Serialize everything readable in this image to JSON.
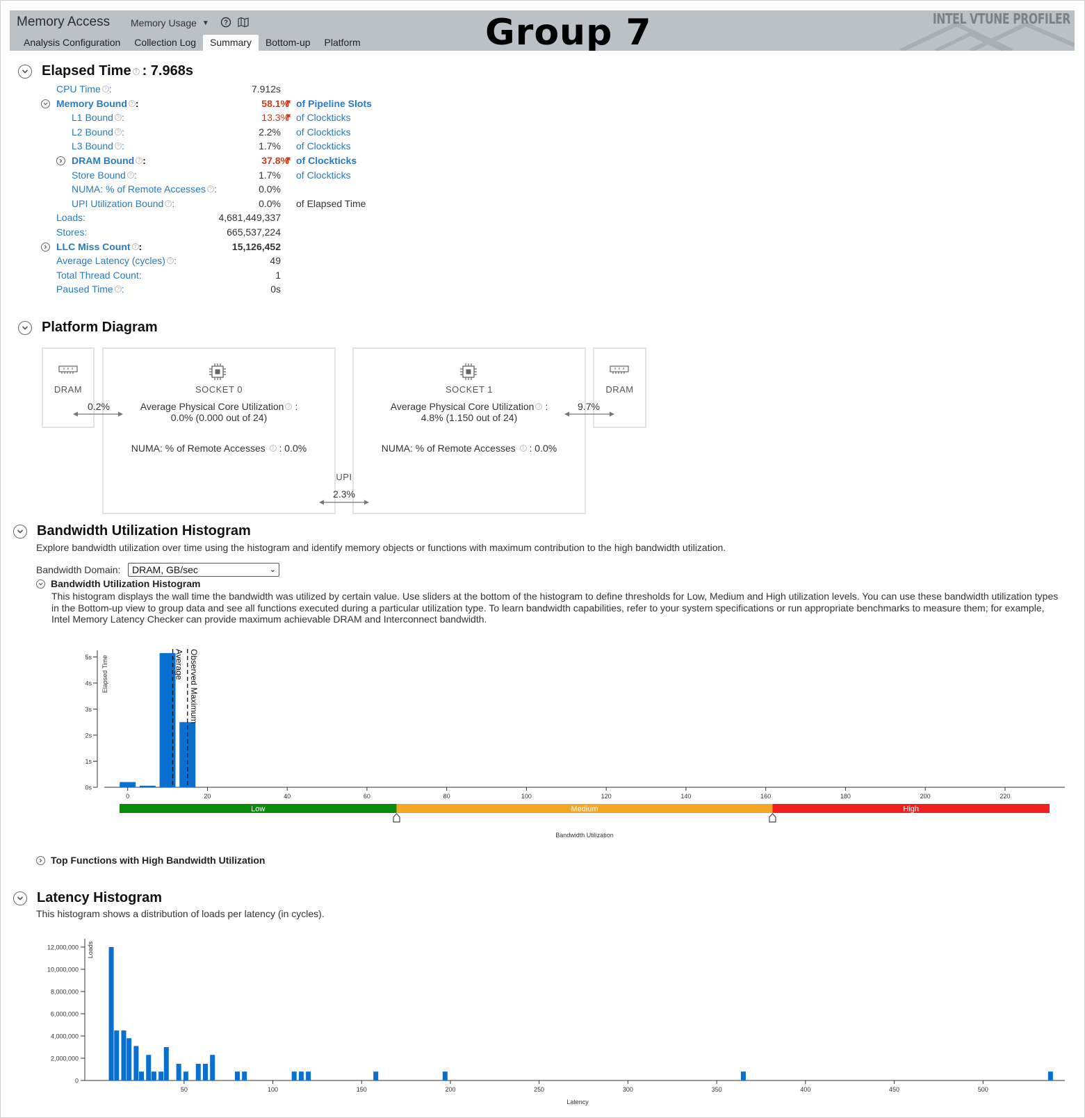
{
  "header": {
    "app_title": "Memory Access",
    "view_dropdown": "Memory Usage",
    "group_title": "Group 7",
    "brand": "INTEL VTUNE PROFILER",
    "tabs": [
      "Analysis Configuration",
      "Collection Log",
      "Summary",
      "Bottom-up",
      "Platform"
    ],
    "active_tab": "Summary"
  },
  "elapsed": {
    "title": "Elapsed Time",
    "value": ": 7.968s",
    "metrics": [
      {
        "label": "CPU Time",
        "value": "7.912s",
        "unit": "",
        "indent": 0,
        "help": true
      },
      {
        "label": "Memory Bound",
        "value": "58.1%",
        "unit": "of Pipeline Slots",
        "indent": 0,
        "help": true,
        "bold": true,
        "red": true,
        "flag": true,
        "toggle": "expanded"
      },
      {
        "label": "L1 Bound",
        "value": "13.3%",
        "unit": "of Clockticks",
        "indent": 1,
        "help": true,
        "red": true,
        "flag": true
      },
      {
        "label": "L2 Bound",
        "value": "2.2%",
        "unit": "of Clockticks",
        "indent": 1,
        "help": true
      },
      {
        "label": "L3 Bound",
        "value": "1.7%",
        "unit": "of Clockticks",
        "indent": 1,
        "help": true
      },
      {
        "label": "DRAM Bound",
        "value": "37.8%",
        "unit": "of Clockticks",
        "indent": 1,
        "help": true,
        "bold": true,
        "red": true,
        "flag": true,
        "toggle": "collapsed"
      },
      {
        "label": "Store Bound",
        "value": "1.7%",
        "unit": "of Clockticks",
        "indent": 1,
        "help": true
      },
      {
        "label": "NUMA: % of Remote Accesses",
        "value": "0.0%",
        "unit": "",
        "indent": 1,
        "help": true
      },
      {
        "label": "UPI Utilization Bound",
        "value": "0.0%",
        "unit": "of Elapsed Time",
        "indent": 1,
        "help": true,
        "unit_dark": true
      },
      {
        "label": "Loads",
        "value": "4,681,449,337",
        "unit": "",
        "indent": 0,
        "help": false
      },
      {
        "label": "Stores",
        "value": "665,537,224",
        "unit": "",
        "indent": 0,
        "help": false
      },
      {
        "label": "LLC Miss Count",
        "value": "15,126,452",
        "unit": "",
        "indent": 0,
        "help": true,
        "bold": true,
        "value_bold": true,
        "toggle": "collapsed"
      },
      {
        "label": "Average Latency (cycles)",
        "value": "49",
        "unit": "",
        "indent": 0,
        "help": true
      },
      {
        "label": "Total Thread Count",
        "value": "1",
        "unit": "",
        "indent": 0,
        "help": false
      },
      {
        "label": "Paused Time",
        "value": "0s",
        "unit": "",
        "indent": 0,
        "help": true
      }
    ]
  },
  "platform": {
    "title": "Platform Diagram",
    "dram_left_label": "DRAM",
    "dram_right_label": "DRAM",
    "socket0": {
      "label": "SOCKET 0",
      "util_label": "Average Physical Core Utilization",
      "util_value": "0.0% (0.000 out of 24)",
      "numa_label": "NUMA: % of Remote Accesses",
      "numa_value": ": 0.0%"
    },
    "socket1": {
      "label": "SOCKET 1",
      "util_label": "Average Physical Core Utilization",
      "util_value": "4.8% (1.150 out of 24)",
      "numa_label": "NUMA: % of Remote Accesses",
      "numa_value": ": 0.0%"
    },
    "link_left": "0.2%",
    "link_right": "9.7%",
    "upi_label": "UPI",
    "upi_value": "2.3%"
  },
  "bandwidth": {
    "title": "Bandwidth Utilization Histogram",
    "description": "Explore bandwidth utilization over time using the histogram and identify memory objects or functions with maximum contribution to the high bandwidth utilization.",
    "domain_label": "Bandwidth Domain:",
    "domain_value": "DRAM, GB/sec",
    "sub_title": "Bandwidth Utilization Histogram",
    "sub_description": "This histogram displays the wall time the bandwidth was utilized by certain value. Use sliders at the bottom of the histogram to define thresholds for Low, Medium and High utilization levels. You can use these bandwidth utilization types in the Bottom-up view to group data and see all functions executed during a particular utilization type. To learn bandwidth capabilities, refer to your system specifications or run appropriate benchmarks to measure them; for example, Intel Memory Latency Checker can provide maximum achievable DRAM and Interconnect bandwidth.",
    "top_functions": "Top Functions with High Bandwidth Utilization",
    "colors": {
      "bar": "#0a6fcf",
      "low": "#0a8a0a",
      "medium": "#f5a623",
      "high": "#f02020"
    }
  },
  "latency": {
    "title": "Latency Histogram",
    "description": "This histogram shows a distribution of loads per latency (in cycles)."
  },
  "chart_data": [
    {
      "type": "bar",
      "xlabel": "Bandwidth Utilization",
      "ylabel": "Elapsed Time",
      "xlim": [
        -5,
        235
      ],
      "ylim": [
        0,
        5.2
      ],
      "xticks": [
        0,
        20,
        40,
        60,
        80,
        100,
        120,
        140,
        160,
        180,
        200,
        220
      ],
      "yticks": [
        0,
        1,
        2,
        3,
        4,
        5
      ],
      "ytick_labels": [
        "0s",
        "1s",
        "2s",
        "3s",
        "4s",
        "5s"
      ],
      "bars": [
        {
          "x0": -2,
          "x1": 2,
          "value": 0.2
        },
        {
          "x0": 3,
          "x1": 7,
          "value": 0.06
        },
        {
          "x0": 8,
          "x1": 12,
          "value": 5.15
        },
        {
          "x0": 13,
          "x1": 17,
          "value": 2.5
        }
      ],
      "markers": [
        {
          "label": "Average",
          "x": 11.3
        },
        {
          "label": "Observed Maximum",
          "x": 15
        }
      ],
      "thresholds": {
        "low_label": "Low",
        "medium_label": "Medium",
        "high_label": "High",
        "low_max": 67,
        "medium_max": 162,
        "range": [
          -3,
          232
        ]
      }
    },
    {
      "type": "bar",
      "xlabel": "Latency",
      "ylabel": "Loads",
      "xlim": [
        -2,
        550
      ],
      "ylim": [
        0,
        12500000
      ],
      "xticks": [
        50,
        100,
        150,
        200,
        250,
        300,
        350,
        400,
        450,
        500
      ],
      "yticks": [
        0,
        2000000,
        4000000,
        6000000,
        8000000,
        10000000,
        12000000
      ],
      "ytick_labels": [
        "0",
        "2,000,000",
        "4,000,000",
        "6,000,000",
        "8,000,000",
        "10,000,000",
        "12,000,000"
      ],
      "bars": [
        {
          "x": 9,
          "value": 12000000
        },
        {
          "x": 12,
          "value": 4500000
        },
        {
          "x": 16,
          "value": 4500000
        },
        {
          "x": 19,
          "value": 3800000
        },
        {
          "x": 23,
          "value": 3100000
        },
        {
          "x": 26,
          "value": 800000
        },
        {
          "x": 30,
          "value": 2300000
        },
        {
          "x": 33,
          "value": 800000
        },
        {
          "x": 37,
          "value": 800000
        },
        {
          "x": 40,
          "value": 3000000
        },
        {
          "x": 47,
          "value": 1500000
        },
        {
          "x": 51,
          "value": 800000
        },
        {
          "x": 58,
          "value": 1500000
        },
        {
          "x": 62,
          "value": 1500000
        },
        {
          "x": 66,
          "value": 2300000
        },
        {
          "x": 80,
          "value": 800000
        },
        {
          "x": 84,
          "value": 800000
        },
        {
          "x": 112,
          "value": 800000
        },
        {
          "x": 116,
          "value": 800000
        },
        {
          "x": 120,
          "value": 800000
        },
        {
          "x": 158,
          "value": 800000
        },
        {
          "x": 197,
          "value": 800000
        },
        {
          "x": 365,
          "value": 800000
        },
        {
          "x": 538,
          "value": 800000
        }
      ]
    }
  ]
}
